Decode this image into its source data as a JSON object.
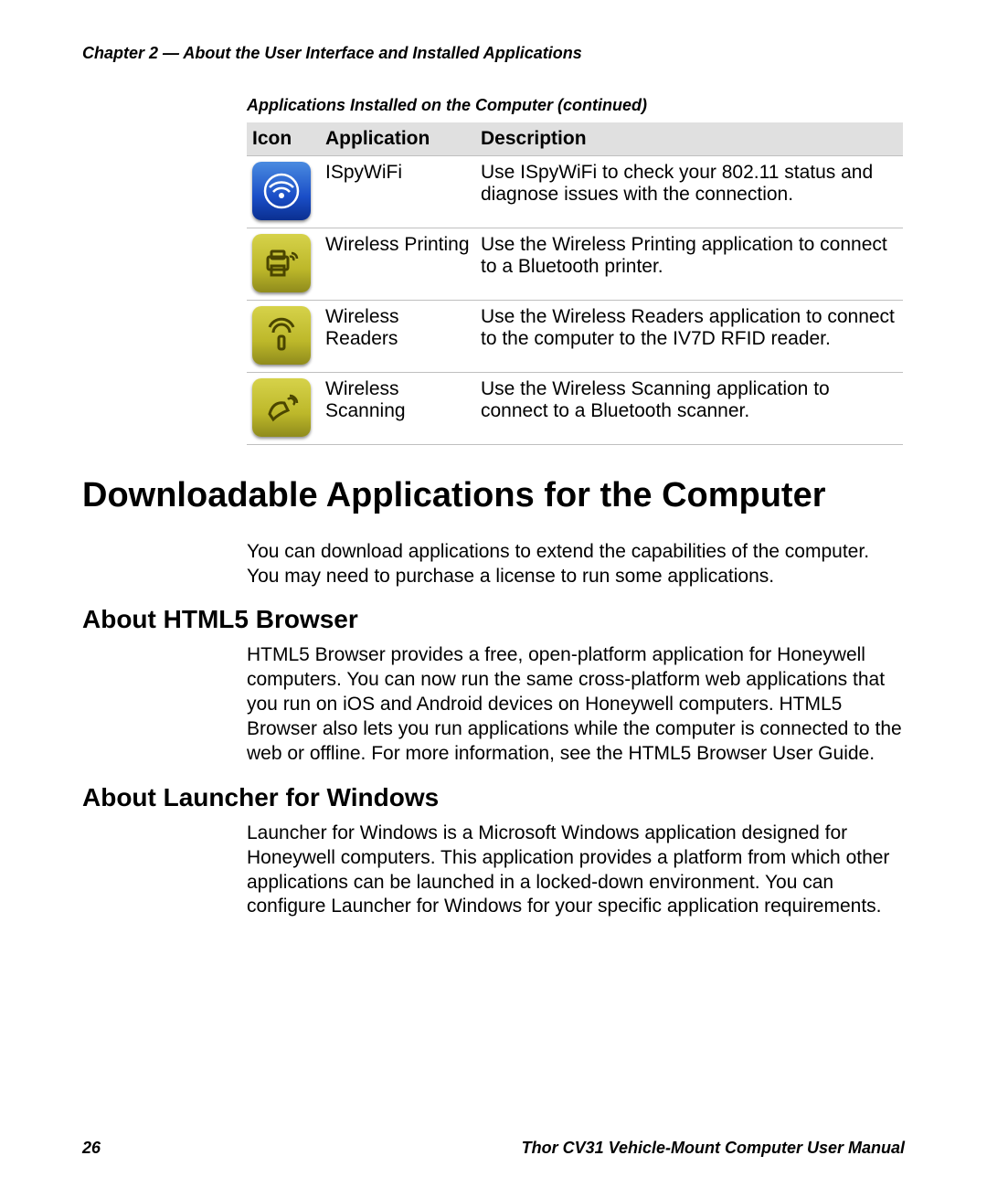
{
  "header": {
    "chapter": "Chapter 2 — About the User Interface and Installed Applications"
  },
  "table": {
    "caption": "Applications Installed on the Computer  (continued)",
    "columns": {
      "icon": "Icon",
      "application": "Application",
      "description": "Description"
    },
    "rows": [
      {
        "icon_name": "wifi-signal-icon",
        "icon_style": "blue",
        "application": "ISpyWiFi",
        "description": "Use ISpyWiFi to check your 802.11 status and diagnose issues with the connection."
      },
      {
        "icon_name": "wireless-printer-icon",
        "icon_style": "olive",
        "application": "Wireless Printing",
        "description": "Use the Wireless Printing application to connect to a Bluetooth printer."
      },
      {
        "icon_name": "wireless-reader-icon",
        "icon_style": "olive",
        "application": "Wireless Readers",
        "description": "Use the Wireless Readers application to connect to the computer to the IV7D RFID reader."
      },
      {
        "icon_name": "wireless-scanner-icon",
        "icon_style": "olive",
        "application": "Wireless Scanning",
        "description": "Use the Wireless Scanning application to connect to a Bluetooth scanner."
      }
    ]
  },
  "section": {
    "title": "Downloadable Applications for the Computer",
    "intro": "You can download applications to extend the capabilities of the computer. You may need to purchase a license to run some applications.",
    "sub1_title": "About HTML5 Browser",
    "sub1_body": "HTML5 Browser provides a free, open-platform application for Honeywell computers. You can now run the same cross-platform web applications that you run on iOS and Android devices on Honeywell computers. HTML5 Browser also lets you run applications while the computer is connected to the web or offline. For more information, see the HTML5 Browser User Guide.",
    "sub2_title": "About Launcher for Windows",
    "sub2_body": "Launcher for Windows is a Microsoft Windows application designed for Honeywell computers. This application provides a platform from which other applications can be launched in a locked-down environment. You can configure Launcher for Windows for your specific application requirements."
  },
  "footer": {
    "page": "26",
    "manual": "Thor CV31 Vehicle-Mount Computer User Manual"
  }
}
